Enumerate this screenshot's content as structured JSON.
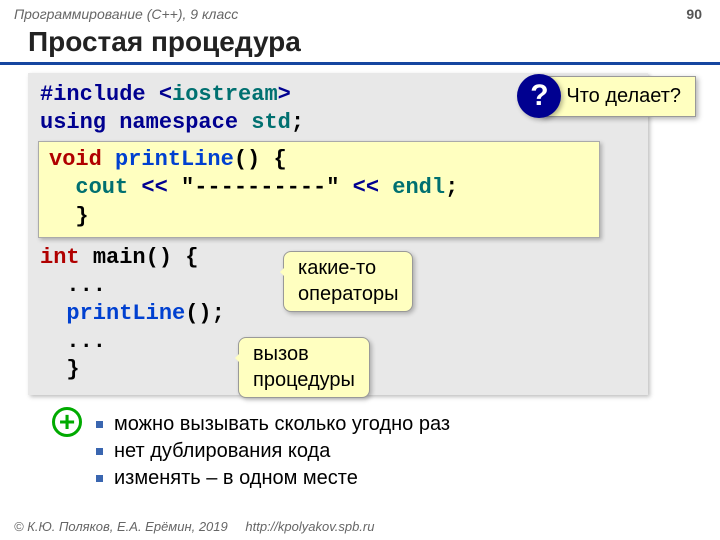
{
  "header": {
    "breadcrumb": "Программирование (C++), 9 класс",
    "page": "90"
  },
  "title": "Простая процедура",
  "code": {
    "l1_pre": "#include <",
    "l1_mid": "iostream",
    "l1_post": ">",
    "l2a": "using",
    "l2b": "namespace",
    "l2c": "std",
    "l2d": ";",
    "inner1a": "void",
    "inner1b": "printLine",
    "inner1c": "() {",
    "inner2a": "cout",
    "inner2b": "<<",
    "inner2c": "\"----------\"",
    "inner2d": "<<",
    "inner2e": "endl",
    "inner2f": ";",
    "inner3": "}",
    "m1a": "int",
    "m1b": "main",
    "m1c": "() {",
    "m2": "...",
    "m3a": "printLine",
    "m3b": "();",
    "m4": "...",
    "m5": "}"
  },
  "callouts": {
    "question_mark": "?",
    "question": "Что делает?",
    "operators": "какие-то\nоператоры",
    "call": "вызов\nпроцедуры"
  },
  "bullets": [
    "можно вызывать сколько угодно раз",
    "нет дублирования кода",
    "изменять – в одном месте"
  ],
  "footer": {
    "copy": "© К.Ю. Поляков, Е.А. Ерёмин, 2019",
    "url": "http://kpolyakov.spb.ru"
  }
}
